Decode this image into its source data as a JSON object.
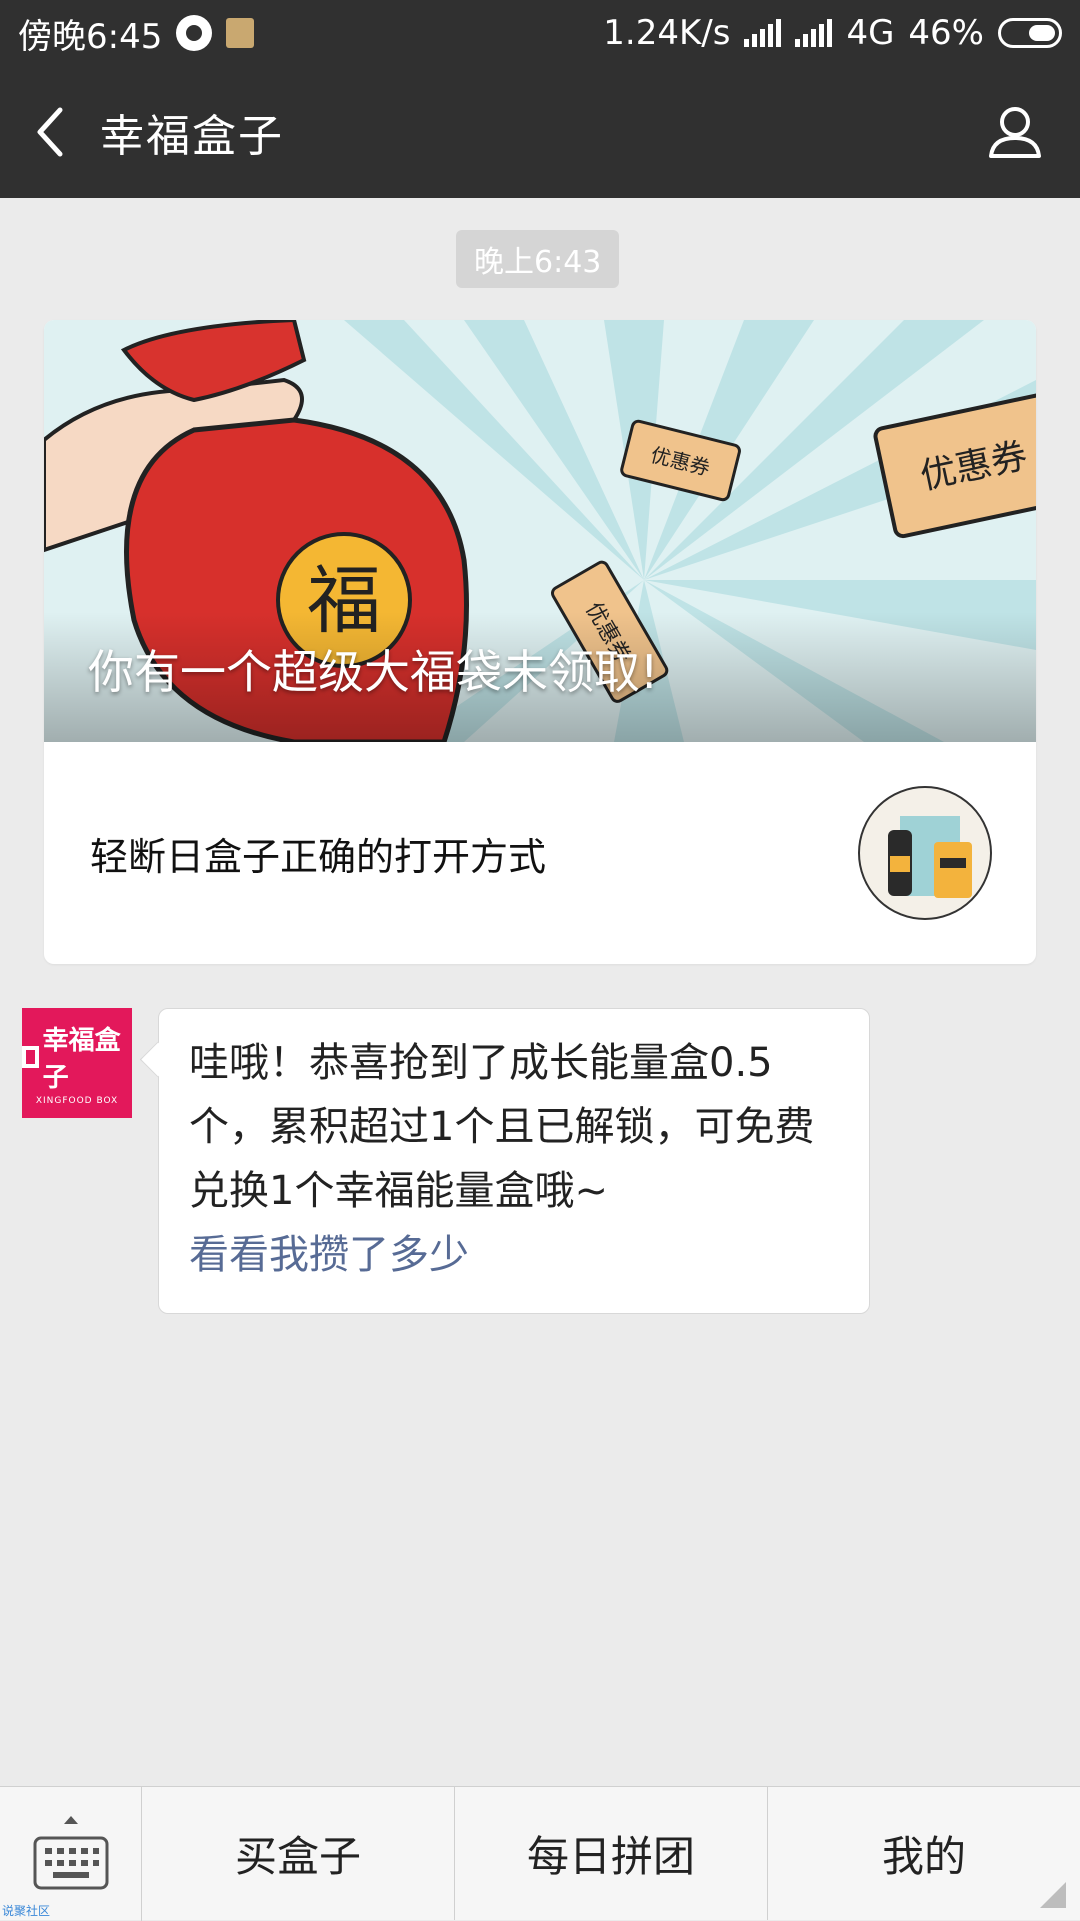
{
  "status_bar": {
    "time": "傍晚6:45",
    "speed": "1.24K/s",
    "network": "4G",
    "battery": "46%"
  },
  "header": {
    "title": "幸福盒子",
    "back_icon": "chevron-left-icon",
    "profile_icon": "person-icon"
  },
  "chat": {
    "timestamp": "晚上6:43",
    "article": {
      "banner_caption": "你有一个超级大福袋未领取!",
      "banner_bag_char": "福",
      "coupon_label": "优惠券",
      "subtitle": "轻断日盒子正确的打开方式"
    },
    "message": {
      "avatar_text": "幸福盒子",
      "avatar_subtext": "XINGFOOD BOX",
      "text": "哇哦！恭喜抢到了成长能量盒0.5个，累积超过1个且已解锁，可免费兑换1个幸福能量盒哦~",
      "link": "看看我攒了多少"
    }
  },
  "bottom_menu": {
    "keyboard_icon": "keyboard-icon",
    "items": [
      "买盒子",
      "每日拼团",
      "我的"
    ]
  },
  "watermark": "说聚社区",
  "colors": {
    "bar_dark": "#303030",
    "chat_bg": "#ebebeb",
    "link": "#576b95",
    "avatar": "#e3185b"
  }
}
